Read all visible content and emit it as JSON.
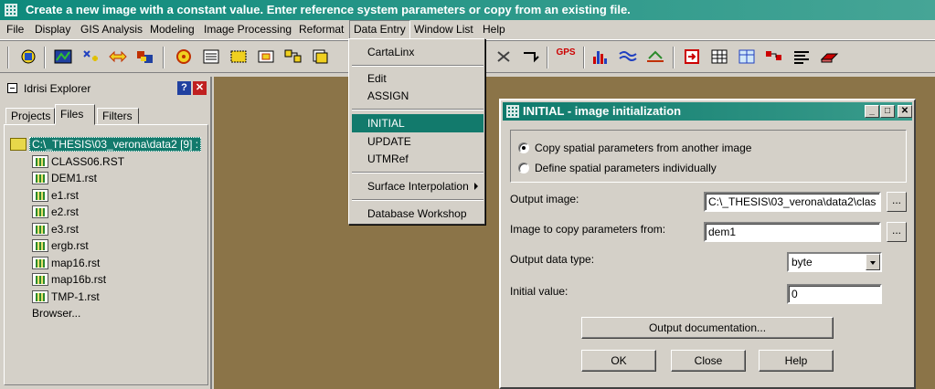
{
  "app_title": "Create a new image with a constant value. Enter reference system parameters or copy from an existing file.",
  "menu": [
    "File",
    "Display",
    "GIS Analysis",
    "Modeling",
    "Image Processing",
    "Reformat",
    "Data Entry",
    "Window List",
    "Help"
  ],
  "explorer": {
    "title": "Idrisi Explorer",
    "help_btn": "?",
    "close_btn": "✕",
    "tabs": [
      "Projects",
      "Files",
      "Filters"
    ],
    "folder": "C:\\_THESIS\\03_verona\\data2 [9] :",
    "files": [
      "CLASS06.RST",
      "DEM1.rst",
      "e1.rst",
      "e2.rst",
      "e3.rst",
      "ergb.rst",
      "map16.rst",
      "map16b.rst",
      "TMP-1.rst"
    ],
    "browser": "Browser..."
  },
  "data_entry_menu": {
    "items": [
      "CartaLinx",
      "Edit",
      "ASSIGN",
      "INITIAL",
      "UPDATE",
      "UTMRef",
      "Surface Interpolation",
      "Database Workshop"
    ],
    "highlighted": "INITIAL"
  },
  "dialog": {
    "title": "INITIAL - image initialization",
    "min_btn": "_",
    "max_btn": "□",
    "close_btn": "✕",
    "radio_copy": "Copy spatial parameters from another image",
    "radio_define": "Define spatial parameters individually",
    "output_image_label": "Output image:",
    "output_image_value": "C:\\_THESIS\\03_verona\\data2\\clas",
    "copy_from_label": "Image to copy parameters from:",
    "copy_from_value": "dem1",
    "data_type_label": "Output data type:",
    "data_type_value": "byte",
    "initial_value_label": "Initial value:",
    "initial_value": "0",
    "doc_button": "Output documentation...",
    "ok_button": "OK",
    "close_button": "Close",
    "help_button": "Help",
    "browse_label": "..."
  },
  "toolbar": {
    "gps_label": "GPS",
    "icons": [
      "open-image-icon",
      "display-launcher-icon",
      "add-layer-icon",
      "swap-icon",
      "composer-icon",
      "symbol-workshop-icon",
      "legend-icon",
      "zoom-window-icon",
      "pan-icon",
      "layer-props-icon",
      "group-icon",
      "clear-icon",
      "pointer-icon",
      "gps-icon",
      "histogram-icon",
      "wave-icon",
      "profile-icon",
      "import-icon",
      "table-icon",
      "grid-icon",
      "flow-icon",
      "list-icon",
      "eraser-icon"
    ]
  }
}
